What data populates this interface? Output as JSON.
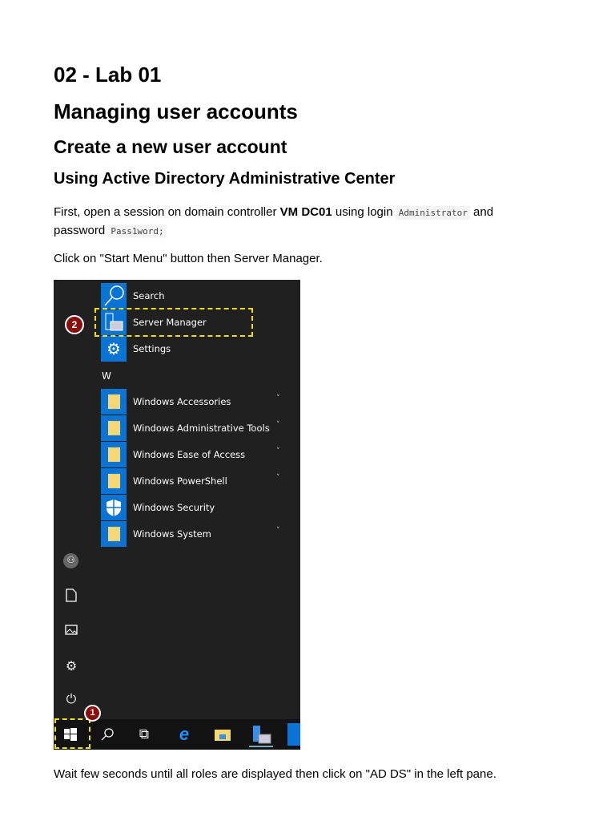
{
  "headings": {
    "h1": "02 - Lab 01",
    "h2": "Managing user accounts",
    "h3": "Create a new user account",
    "h4": "Using Active Directory Administrative Center"
  },
  "para1": {
    "t1": "First, open a session on domain controller ",
    "bold": "VM DC01",
    "t2": " using login ",
    "code1": "Administrator",
    "t3": " and password ",
    "code2": "Pass1word;"
  },
  "para2": "Click on \"Start Menu\" button then Server Manager.",
  "start_menu": {
    "top_items": [
      {
        "label": "Search"
      },
      {
        "label": "Server Manager"
      },
      {
        "label": "Settings"
      }
    ],
    "section_letter": "W",
    "list_items": [
      {
        "label": "Windows Accessories"
      },
      {
        "label": "Windows Administrative Tools"
      },
      {
        "label": "Windows Ease of Access"
      },
      {
        "label": "Windows PowerShell"
      },
      {
        "label": "Windows Security"
      },
      {
        "label": "Windows System"
      }
    ],
    "chevron": "˅",
    "badges": [
      "1",
      "2"
    ]
  },
  "para3": "Wait few seconds until all roles are displayed then click on \"AD DS\" in the left pane.",
  "colors": {
    "tile": "#0a74d4",
    "highlight": "#f0e010",
    "badge": "#8b0e0e"
  }
}
